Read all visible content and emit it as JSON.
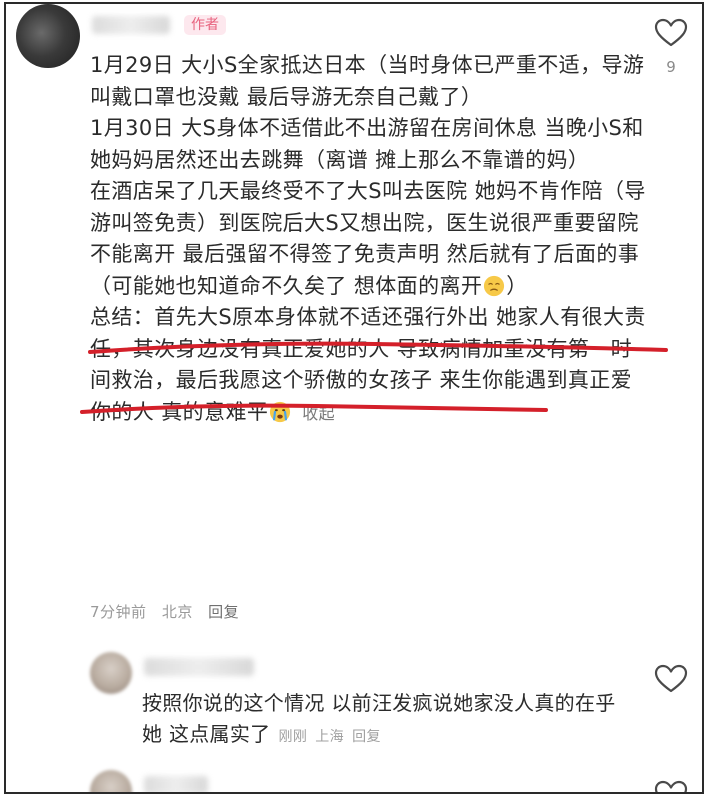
{
  "main_comment": {
    "author_badge": "作者",
    "like_count": "9",
    "paragraphs": [
      "1月29日 大小S全家抵达日本（当时身体已严重不适，导游叫戴口罩也没戴 最后导游无奈自己戴了）",
      "1月30日 大S身体不适借此不出游留在房间休息 当晚小S和她妈妈居然还出去跳舞（离谱 摊上那么不靠谱的妈）",
      "在酒店呆了几天最终受不了大S叫去医院 她妈不肯作陪（导游叫签免责）到医院后大S又想出院，医生说很严重要留院不能离开 最后强留不得签了免责声明 然后就有了后面的事（可能她也知道命不久矣了 想体面的离开"
    ],
    "para3_tail": "）",
    "summary": "总结：首先大S原本身体就不适还强行外出 她家人有很大责任，其次身边没有真正爱她的人 导致病情加重没有第一时间救治，最后我愿这个骄傲的女孩子 来生你能遇到真正爱你的人 真的意难平",
    "collapse_label": "收起",
    "time": "7分钟前",
    "location": "北京",
    "reply_label": "回复",
    "emoji_sad": "sad-face-emoji",
    "emoji_crying": "crying-face-emoji"
  },
  "reply_comment": {
    "text": "按照你说的这个情况 以前汪发疯说她家没人真的在乎她 这点属实了",
    "time": "刚刚",
    "location": "上海",
    "reply_label": "回复"
  },
  "icons": {
    "like": "heart-outline-icon"
  },
  "colors": {
    "badge_text": "#e8637f",
    "badge_bg": "#fde8ee",
    "annotation_red": "#d4202a"
  }
}
